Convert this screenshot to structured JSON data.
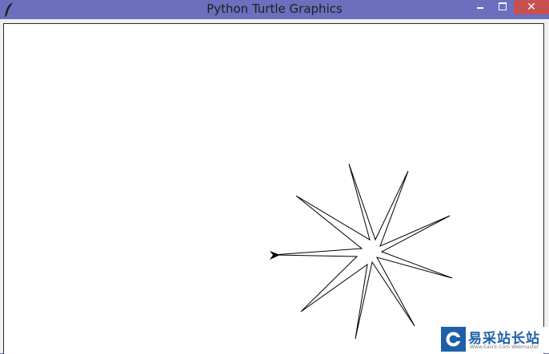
{
  "window": {
    "title": "Python Turtle Graphics",
    "colors": {
      "titlebar": "#6b6fbd",
      "close_button": "#c75050",
      "canvas": "#ffffff",
      "stroke": "#000000"
    },
    "controls": {
      "minimize_icon": "minimize-icon",
      "maximize_icon": "maximize-icon",
      "close_icon": "close-icon",
      "close_glyph": "✕"
    }
  },
  "watermark": {
    "text": "易采站长站",
    "subtext": "Www.Easck.Com  Webmaster",
    "logo_icon": "easck-logo-icon",
    "color": "#1f5fa8"
  }
}
